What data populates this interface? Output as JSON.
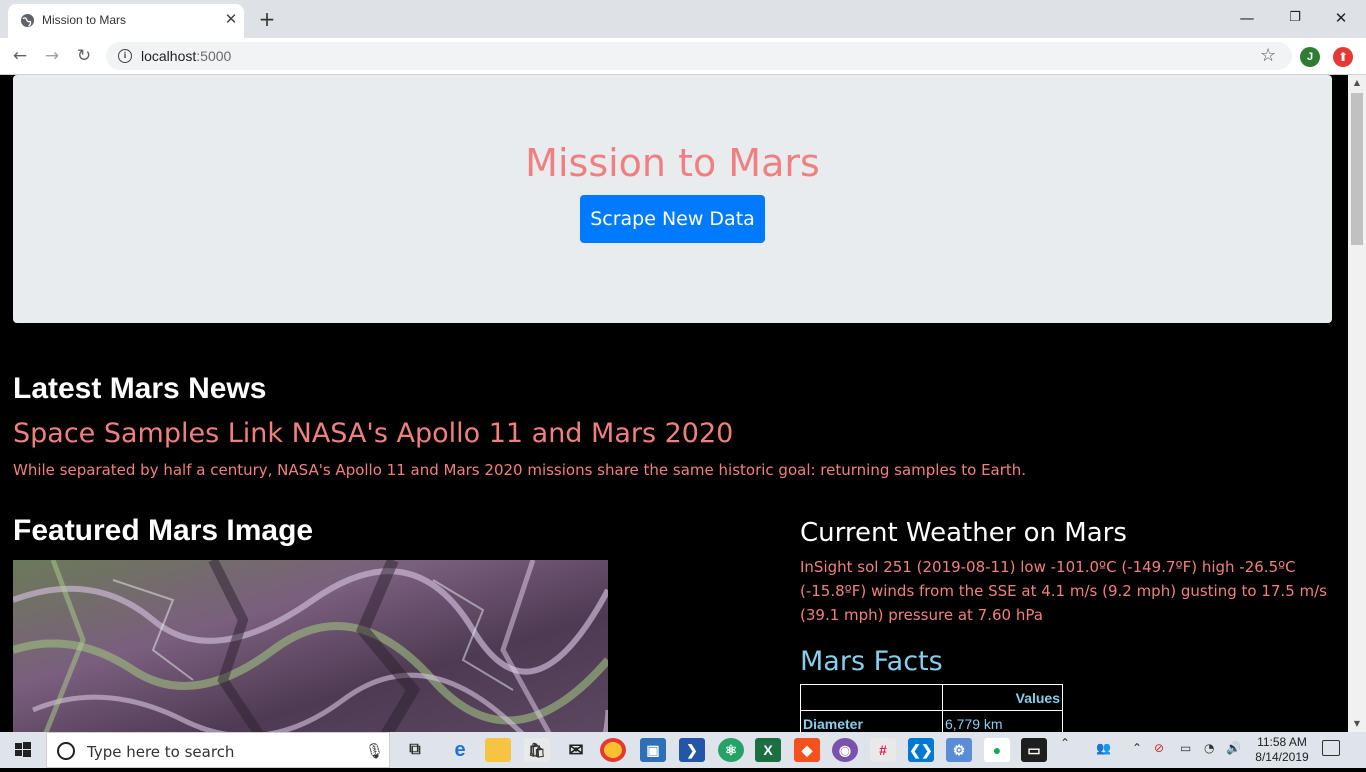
{
  "browser": {
    "tab_title": "Mission to Mars",
    "new_tab": "+",
    "close_tab": "✕",
    "url_host": "localhost",
    "url_port": ":5000",
    "profile_initial": "J"
  },
  "page": {
    "jumbotron": {
      "title": "Mission to Mars",
      "button_label": "Scrape New Data"
    },
    "news": {
      "section_heading": "Latest Mars News",
      "title": "Space Samples Link NASA's Apollo 11 and Mars 2020",
      "paragraph": "While separated by half a century, NASA's Apollo 11 and Mars 2020 missions share the same historic goal: returning samples to Earth."
    },
    "featured_image": {
      "heading": "Featured Mars Image"
    },
    "weather": {
      "heading": "Current Weather on Mars",
      "text": "InSight sol 251 (2019-08-11) low -101.0ºC (-149.7ºF) high -26.5ºC (-15.8ºF) winds from the SSE at 4.1 m/s (9.2 mph) gusting to 17.5 m/s (39.1 mph) pressure at 7.60 hPa"
    },
    "facts": {
      "heading": "Mars Facts",
      "column_header": "Values",
      "rows": [
        {
          "label": "Diameter",
          "value": "6,779 km"
        }
      ]
    }
  },
  "taskbar": {
    "search_placeholder": "Type here to search",
    "time": "11:58 AM",
    "date": "8/14/2019"
  },
  "colors": {
    "accent_salmon": "#f08080",
    "button_blue": "#007bff",
    "facts_skyblue": "#87ceeb"
  }
}
